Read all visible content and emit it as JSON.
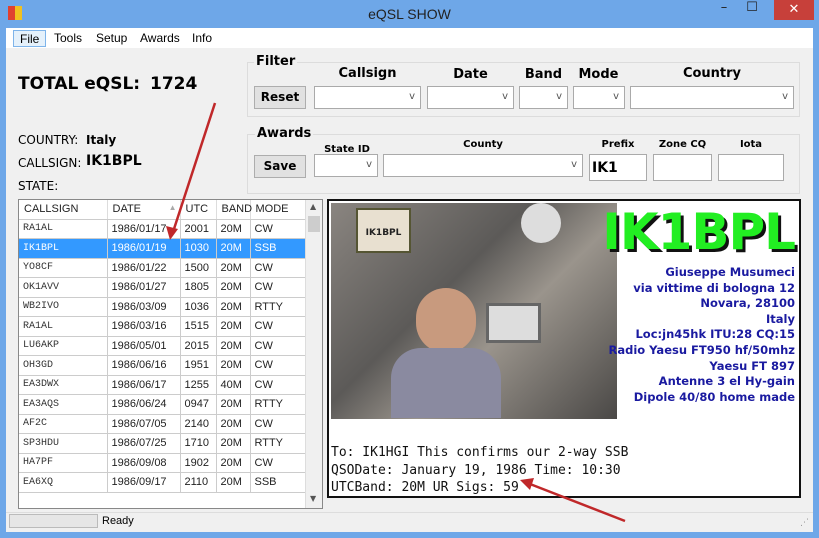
{
  "window": {
    "title": "eQSL SHOW",
    "minimize": "–",
    "maximize": "☐",
    "close": "✕"
  },
  "menu": [
    "File",
    "Tools",
    "Setup",
    "Awards",
    "Info"
  ],
  "summary": {
    "total_label": "TOTAL eQSL:",
    "total_value": "1724",
    "country_label": "COUNTRY:",
    "country": "Italy",
    "callsign_label": "CALLSIGN:",
    "callsign": "IK1BPL",
    "state_label": "STATE:",
    "state": ""
  },
  "filter": {
    "title": "Filter",
    "reset": "Reset",
    "labels": [
      "Callsign",
      "Date",
      "Band",
      "Mode",
      "Country"
    ]
  },
  "awards": {
    "title": "Awards",
    "save": "Save",
    "state_id": "State ID",
    "county": "County",
    "prefix": "Prefix",
    "prefix_value": "IK1",
    "zone_cq": "Zone CQ",
    "iota": "Iota"
  },
  "table": {
    "columns": [
      "CALLSIGN",
      "DATE",
      "UTC",
      "BAND",
      "MODE"
    ],
    "sort_column": "DATE",
    "selected_row": 1,
    "rows": [
      [
        "RA1AL",
        "1986/01/17",
        "2001",
        "20M",
        "CW"
      ],
      [
        "IK1BPL",
        "1986/01/19",
        "1030",
        "20M",
        "SSB"
      ],
      [
        "YO8CF",
        "1986/01/22",
        "1500",
        "20M",
        "CW"
      ],
      [
        "OK1AVV",
        "1986/01/27",
        "1805",
        "20M",
        "CW"
      ],
      [
        "WB2IVO",
        "1986/03/09",
        "1036",
        "20M",
        "RTTY"
      ],
      [
        "RA1AL",
        "1986/03/16",
        "1515",
        "20M",
        "CW"
      ],
      [
        "LU6AKP",
        "1986/05/01",
        "2015",
        "20M",
        "CW"
      ],
      [
        "OH3GD",
        "1986/06/16",
        "1951",
        "20M",
        "CW"
      ],
      [
        "EA3DWX",
        "1986/06/17",
        "1255",
        "40M",
        "CW"
      ],
      [
        "EA3AQS",
        "1986/06/24",
        "0947",
        "20M",
        "RTTY"
      ],
      [
        "AF2C",
        "1986/07/05",
        "2140",
        "20M",
        "CW"
      ],
      [
        "SP3HDU",
        "1986/07/25",
        "1710",
        "20M",
        "RTTY"
      ],
      [
        "HA7PF",
        "1986/09/08",
        "1902",
        "20M",
        "CW"
      ],
      [
        "EA6XQ",
        "1986/09/17",
        "2110",
        "20M",
        "SSB"
      ]
    ]
  },
  "card": {
    "callsign": "IK1BPL",
    "photo_badge": "IK1BPL",
    "address": [
      "Giuseppe Musumeci",
      "via vittime di bologna 12",
      "Novara,  28100",
      "Italy",
      "Loc:jn45hk ITU:28 CQ:15",
      "Radio Yaesu FT950 hf/50mhz",
      "Yaesu FT 897",
      "Antenne 3 el Hy-gain",
      "Dipole 40/80 home made"
    ],
    "line1": "To: IK1HGI  This confirms our 2-way SSB",
    "line2": "QSODate: January 19, 1986  Time: 10:30",
    "line3": "UTCBand: 20M UR Sigs: 59"
  },
  "status": {
    "text": "Ready"
  },
  "colors": {
    "titlebar": "#6ea7e8",
    "selection": "#3399ff",
    "card_call": "#22ee22",
    "card_text": "#1a1aa0",
    "arrow": "#c0282a"
  }
}
